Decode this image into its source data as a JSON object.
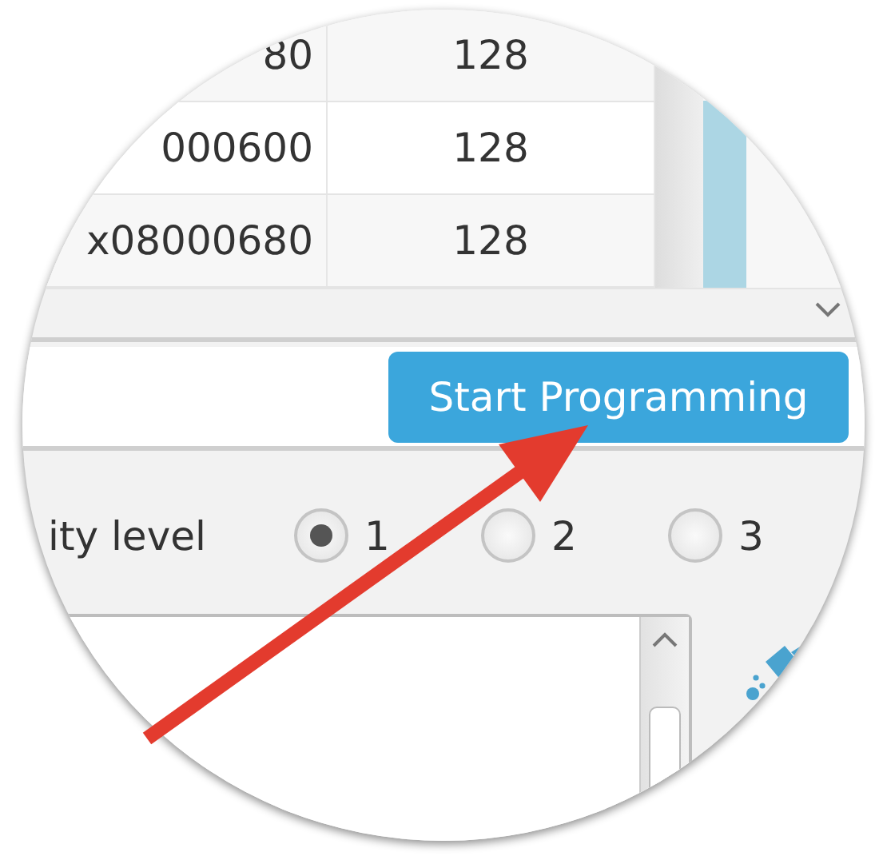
{
  "table": {
    "rows": [
      {
        "cells": [
          "80",
          "128"
        ]
      },
      {
        "cells": [
          "000600",
          "128"
        ]
      },
      {
        "cells": [
          "x08000680",
          "128"
        ]
      }
    ]
  },
  "program_button": {
    "label": "Start Programming"
  },
  "level_setting": {
    "label": "ity level",
    "options": [
      {
        "label": "1",
        "selected": true
      },
      {
        "label": "2",
        "selected": false
      },
      {
        "label": "3",
        "selected": false
      }
    ]
  }
}
